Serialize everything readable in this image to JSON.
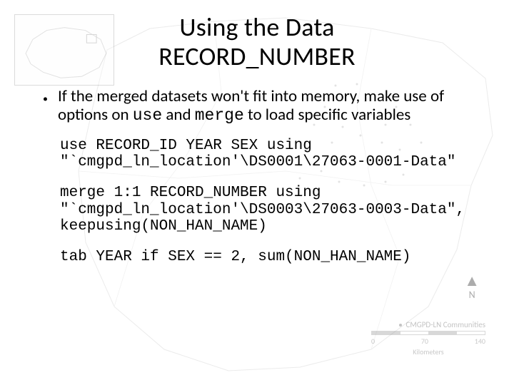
{
  "title_line1": "Using the Data",
  "title_line2": "RECORD_NUMBER",
  "bullet": {
    "pre": "If the merged datasets won't fit into memory, make use of options on ",
    "code1": "use",
    "mid": " and ",
    "code2": "merge",
    "post": " to load specific variables"
  },
  "code_blocks": {
    "block1": "use RECORD_ID YEAR SEX using \"`cmgpd_ln_location'\\DS0001\\27063-0001-Data\"",
    "block2": "merge 1:1 RECORD_NUMBER using \"`cmgpd_ln_location'\\DS0003\\27063-0003-Data\", keepusing(NON_HAN_NAME)",
    "block3": "tab YEAR if SEX == 2, sum(NON_HAN_NAME)"
  },
  "map": {
    "compass_label": "N",
    "legend_label": "CMGPD-LN Communities",
    "scale_unit": "Kilometers",
    "scale_ticks": [
      "0",
      "70",
      "140"
    ]
  }
}
